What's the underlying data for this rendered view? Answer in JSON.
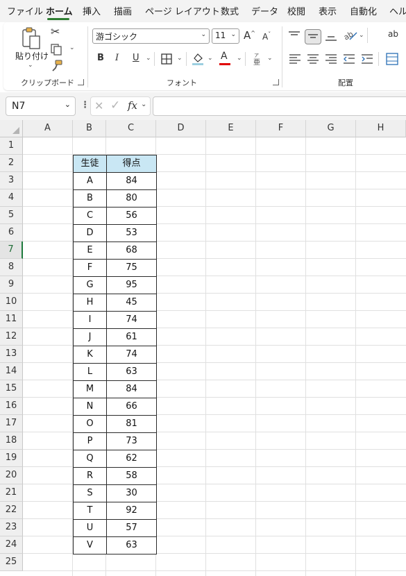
{
  "menu": {
    "tabs": [
      "ファイル",
      "ホーム",
      "挿入",
      "描画",
      "ページ レイアウト",
      "数式",
      "データ",
      "校閲",
      "表示",
      "自動化",
      "ヘル"
    ],
    "active": "ホーム"
  },
  "ribbon": {
    "clipboard": {
      "paste_label": "貼り付け",
      "group_label": "クリップボード"
    },
    "font": {
      "font_name": "游ゴシック",
      "font_size": "11",
      "grow_label": "A",
      "shrink_label": "A",
      "bold": "B",
      "italic": "I",
      "underline": "U",
      "font_color_letter": "A",
      "group_label": "フォント",
      "font_color": "#e00000",
      "fill_color": "#9ccfe0"
    },
    "alignment": {
      "group_label": "配置",
      "wrap_label": "ab"
    }
  },
  "formula_bar": {
    "name_box": "N7",
    "fx_label": "fx",
    "formula": ""
  },
  "sheet": {
    "columns": [
      "A",
      "B",
      "C",
      "D",
      "E",
      "F",
      "G",
      "H"
    ],
    "rows": [
      "1",
      "2",
      "3",
      "4",
      "5",
      "6",
      "7",
      "8",
      "9",
      "10",
      "11",
      "12",
      "13",
      "14",
      "15",
      "16",
      "17",
      "18",
      "19",
      "20",
      "21",
      "22",
      "23",
      "24",
      "25"
    ],
    "selected_row": "7",
    "header_fill": "#c9e7f4",
    "table": {
      "headers": [
        "生徒",
        "得点"
      ],
      "rows": [
        [
          "A",
          "84"
        ],
        [
          "B",
          "80"
        ],
        [
          "C",
          "56"
        ],
        [
          "D",
          "53"
        ],
        [
          "E",
          "68"
        ],
        [
          "F",
          "75"
        ],
        [
          "G",
          "95"
        ],
        [
          "H",
          "45"
        ],
        [
          "I",
          "74"
        ],
        [
          "J",
          "61"
        ],
        [
          "K",
          "74"
        ],
        [
          "L",
          "63"
        ],
        [
          "M",
          "84"
        ],
        [
          "N",
          "66"
        ],
        [
          "O",
          "81"
        ],
        [
          "P",
          "73"
        ],
        [
          "Q",
          "62"
        ],
        [
          "R",
          "58"
        ],
        [
          "S",
          "30"
        ],
        [
          "T",
          "92"
        ],
        [
          "U",
          "57"
        ],
        [
          "V",
          "63"
        ]
      ]
    }
  }
}
